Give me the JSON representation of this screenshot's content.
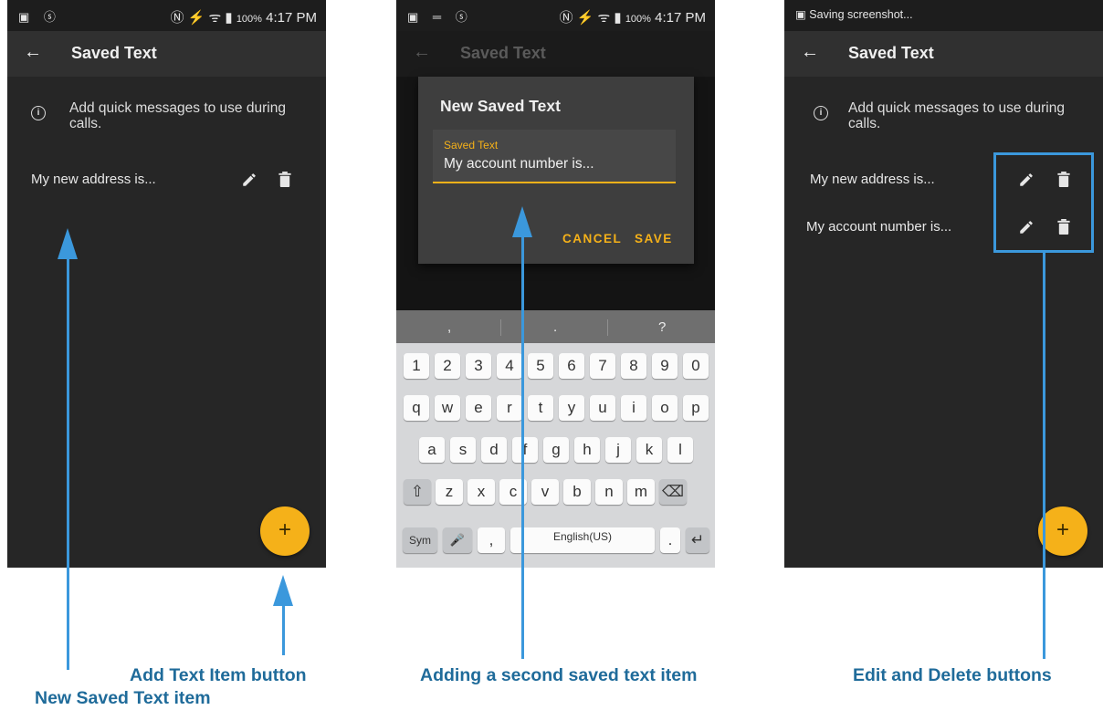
{
  "screens": {
    "left": {
      "status_left": "▣ ⓢ",
      "status_right_icons": "Ⓝ ⚡ ᯤ ▮",
      "battery": "100%",
      "time": "4:17 PM",
      "title": "Saved Text",
      "info": "Add quick messages to use during calls.",
      "items": [
        "My new address is..."
      ],
      "fab": "+"
    },
    "middle": {
      "status_left": "▣ ═ ⓢ",
      "status_right_icons": "Ⓝ ⚡ ᯤ ▮",
      "battery": "100%",
      "time": "4:17 PM",
      "title": "Saved Text",
      "dialog": {
        "title": "New Saved Text",
        "field_label": "Saved Text",
        "field_value": "My account number is...",
        "cancel": "CANCEL",
        "save": "SAVE"
      },
      "keyboard": {
        "suggestions": [
          ",",
          ".",
          "?"
        ],
        "row1": [
          "1",
          "2",
          "3",
          "4",
          "5",
          "6",
          "7",
          "8",
          "9",
          "0"
        ],
        "row2": [
          "q",
          "w",
          "e",
          "r",
          "t",
          "y",
          "u",
          "i",
          "o",
          "p"
        ],
        "row3": [
          "a",
          "s",
          "d",
          "f",
          "g",
          "h",
          "j",
          "k",
          "l"
        ],
        "row4": [
          "⇧",
          "z",
          "x",
          "c",
          "v",
          "b",
          "n",
          "m",
          "⌫"
        ],
        "sym": "Sym",
        "mic": "🎤",
        "comma": ",",
        "space_label": "English(US)",
        "period": ".",
        "enter": "↵"
      }
    },
    "right": {
      "status_text": "Saving screenshot...",
      "title": "Saved Text",
      "info": "Add quick messages to use during calls.",
      "items": [
        "My new address is...",
        "My account number is..."
      ],
      "fab": "+"
    }
  },
  "captions": {
    "add_text": "Add Text Item button",
    "new_item": "New Saved Text item",
    "adding_second": "Adding a second saved text item",
    "edit_delete": "Edit and Delete buttons"
  },
  "colors": {
    "accent": "#f5b119",
    "annotation": "#3b98dc",
    "caption": "#1f6b9a",
    "background_dark": "#262626"
  },
  "icons": [
    "back-arrow-icon",
    "info-icon",
    "pencil-icon",
    "trash-icon",
    "plus-icon"
  ]
}
